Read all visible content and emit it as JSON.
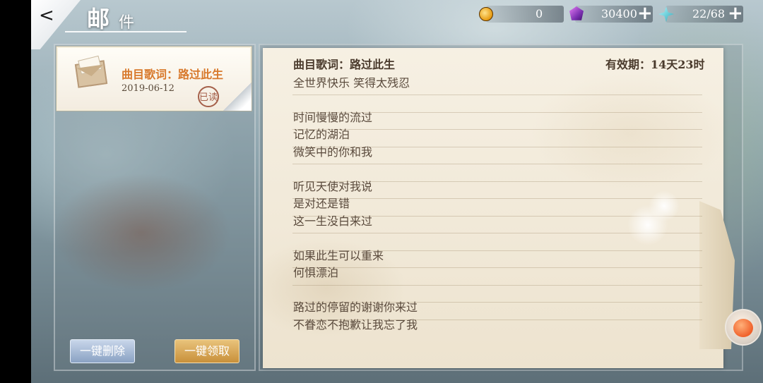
{
  "header": {
    "back_label": "<",
    "title_main": "邮",
    "title_sub": "件"
  },
  "currency": {
    "coin": {
      "icon": "gold-coin-icon",
      "value": "0"
    },
    "gem": {
      "icon": "purple-gem-icon",
      "value": "30400"
    },
    "stamina": {
      "icon": "star-shard-icon",
      "value": "22/68"
    },
    "plus_label": "+"
  },
  "mail_list": {
    "items": [
      {
        "title": "曲目歌词：路过此生",
        "date": "2019-06-12",
        "status_stamp": "已读",
        "icon": "envelope-icon"
      }
    ]
  },
  "actions": {
    "delete_all": "一键删除",
    "claim_all": "一键领取"
  },
  "letter": {
    "title": "曲目歌词：路过此生",
    "expiry": "有效期：14天23时",
    "lines": [
      "全世界快乐 笑得太残忍",
      "",
      "时间慢慢的流过",
      "记忆的湖泊",
      "微笑中的你和我",
      "",
      "听见天使对我说",
      "是对还是错",
      "这一生没白来过",
      "",
      "如果此生可以重来",
      "何惧漂泊",
      "",
      "路过的停留的谢谢你来过",
      "不眷恋不抱歉让我忘了我"
    ]
  },
  "colors": {
    "mail_title": "#d8792c",
    "delete_button": "#8aa2c3",
    "claim_button": "#c8903a",
    "letter_text": "#5a4a3c"
  }
}
